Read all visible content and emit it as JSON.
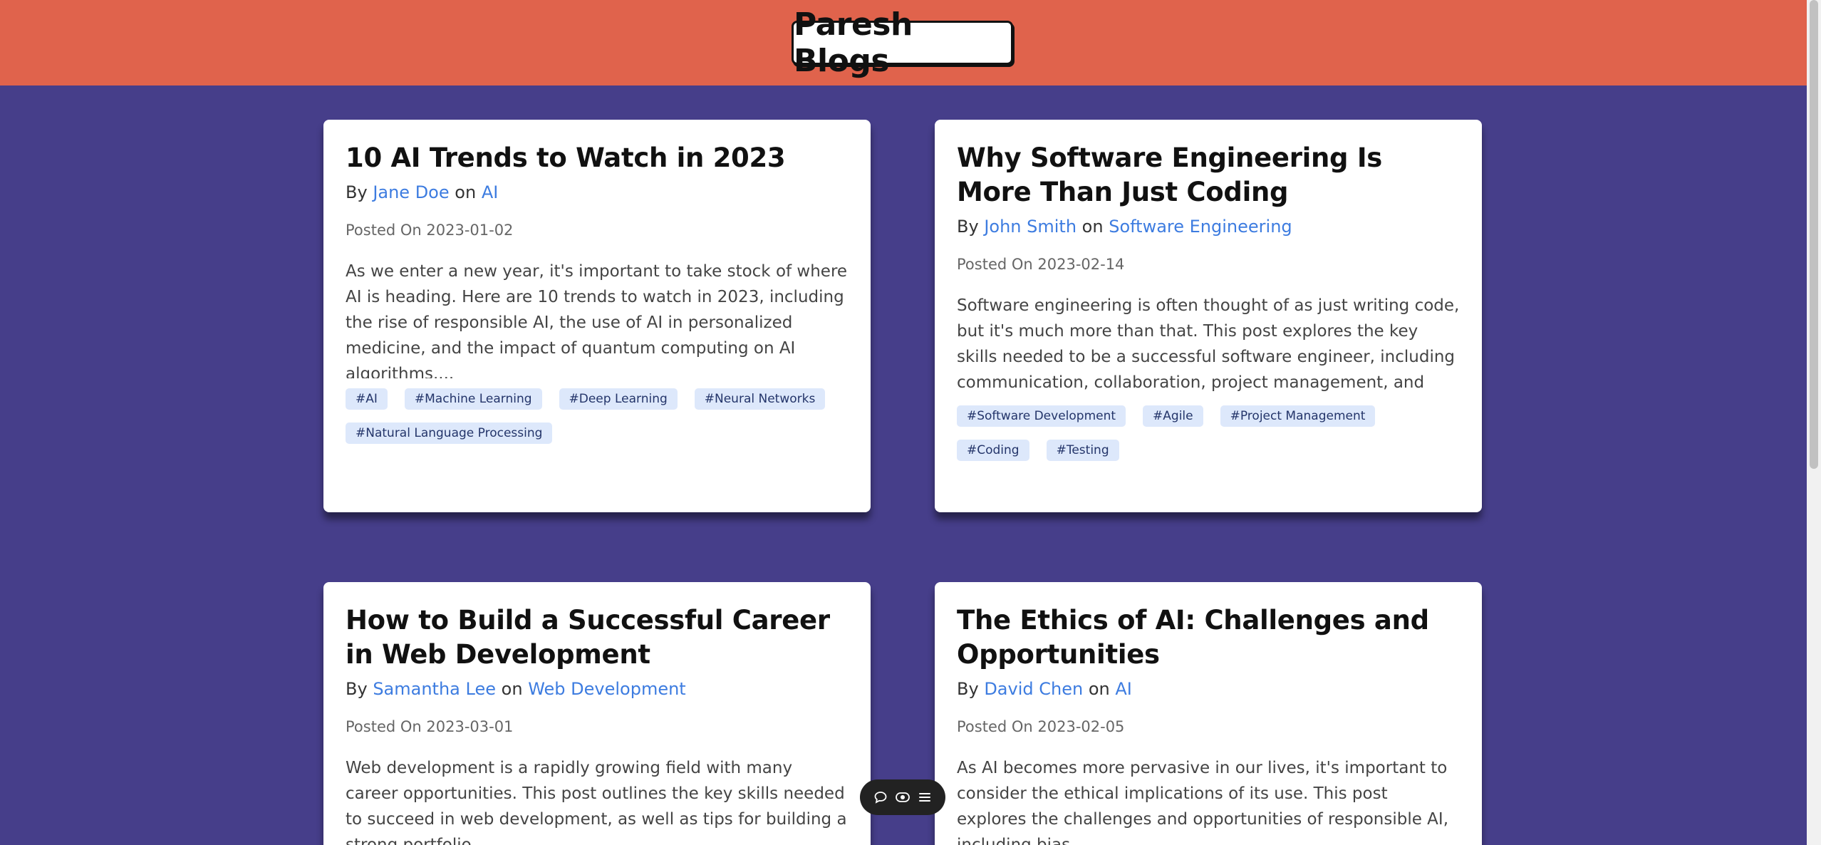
{
  "site": {
    "title": "Paresh Blogs"
  },
  "posts": [
    {
      "title": "10 AI Trends to Watch in 2023",
      "by_prefix": "By",
      "author": "Jane Doe",
      "on_word": "on",
      "category": "AI",
      "posted": "Posted On 2023-01-02",
      "excerpt": "As we enter a new year, it's important to take stock of where AI is heading. Here are 10 trends to watch in 2023, including the rise of responsible AI, the use of AI in personalized medicine, and the impact of quantum computing on AI algorithms....",
      "tags": [
        "#AI",
        "#Machine Learning",
        "#Deep Learning",
        "#Neural Networks",
        "#Natural Language Processing"
      ]
    },
    {
      "title": "Why Software Engineering Is More Than Just Coding",
      "by_prefix": "By",
      "author": "John Smith",
      "on_word": "on",
      "category": "Software Engineering",
      "posted": "Posted On 2023-02-14",
      "excerpt": "Software engineering is often thought of as just writing code, but it's much more than that. This post explores the key skills needed to be a successful software engineer, including communication, collaboration, project management, and testing....",
      "tags": [
        "#Software Development",
        "#Agile",
        "#Project Management",
        "#Coding",
        "#Testing"
      ]
    },
    {
      "title": "How to Build a Successful Career in Web Development",
      "by_prefix": "By",
      "author": "Samantha Lee",
      "on_word": "on",
      "category": "Web Development",
      "posted": "Posted On 2023-03-01",
      "excerpt": "Web development is a rapidly growing field with many career opportunities. This post outlines the key skills needed to succeed in web development, as well as tips for building a strong portfolio,",
      "tags": []
    },
    {
      "title": "The Ethics of AI: Challenges and Opportunities",
      "by_prefix": "By",
      "author": "David Chen",
      "on_word": "on",
      "category": "AI",
      "posted": "Posted On 2023-02-05",
      "excerpt": "As AI becomes more pervasive in our lives, it's important to consider the ethical implications of its use. This post explores the challenges and opportunities of responsible AI, including bias,",
      "tags": []
    }
  ],
  "floating_toolbar": {
    "icons": [
      "comment-icon",
      "eye-toggle-icon",
      "menu-icon"
    ]
  }
}
